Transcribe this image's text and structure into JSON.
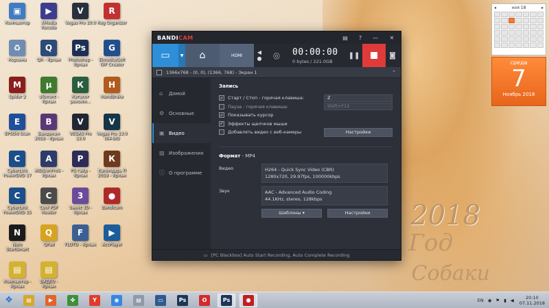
{
  "desktop": {
    "icons": [
      {
        "label": "Компьютер",
        "color": "#3f7cc4",
        "glyph": "▣"
      },
      {
        "label": "XMedia Recode",
        "color": "#3d3d8f",
        "glyph": "▶"
      },
      {
        "label": "Vegas Pro 10.0",
        "color": "#29303d",
        "glyph": "V"
      },
      {
        "label": "Reg Organizer",
        "color": "#c23030",
        "glyph": "R"
      },
      {
        "label": "Корзина",
        "color": "#6f8db3",
        "glyph": "♻"
      },
      {
        "label": "QR - Ярлык",
        "color": "#2c4b78",
        "glyph": "Q"
      },
      {
        "label": "Photoshop - Ярлык",
        "color": "#1d2f55",
        "glyph": "Ps"
      },
      {
        "label": "Elmedia/Soft GIF Creator",
        "color": "#224e8e",
        "glyph": "G"
      },
      {
        "label": "Spider 2",
        "color": "#8c1d1d",
        "glyph": "M"
      },
      {
        "label": "uTorrent - Ярлык",
        "color": "#3f7a2e",
        "glyph": "µ"
      },
      {
        "label": "Каталог рекомм...",
        "color": "#2b5d3f",
        "glyph": "К"
      },
      {
        "label": "HandBrake",
        "color": "#b35a1d",
        "glyph": "H"
      },
      {
        "label": "EPSON Scan",
        "color": "#1f4e9a",
        "glyph": "E"
      },
      {
        "label": "Бандикам 2018 - Ярлык",
        "color": "#5b3777",
        "glyph": "B"
      },
      {
        "label": "VEGAS Pro 13.0",
        "color": "#1f2634",
        "glyph": "V"
      },
      {
        "label": "Vegas Pro 13.0 (64-bit)",
        "color": "#163547",
        "glyph": "V"
      },
      {
        "label": "CyberLink PowerDVD 17",
        "color": "#1b4e8a",
        "glyph": "C"
      },
      {
        "label": "AIDS/enProS - Ярлык",
        "color": "#2d3c6a",
        "glyph": "A"
      },
      {
        "label": "PS гайд - Ярлык",
        "color": "#2c2c57",
        "glyph": "P"
      },
      {
        "label": "Календарь П 2018 - Ярлык",
        "color": "#6e3a1d",
        "glyph": "К"
      },
      {
        "label": "CyberLink PowerDVD 15",
        "color": "#1b4e8a",
        "glyph": "C"
      },
      {
        "label": "Cool PDF Reader",
        "color": "#4b4b4b",
        "glyph": "C"
      },
      {
        "label": "Sweet 3D - Ярлык",
        "color": "#6a4b9a",
        "glyph": "3"
      },
      {
        "label": "Bandicam",
        "color": "#b02929",
        "glyph": "●"
      },
      {
        "label": "Nero StartSmart",
        "color": "#1b1b1b",
        "glyph": "N"
      },
      {
        "label": "QPad",
        "color": "#d8a321",
        "glyph": "Q"
      },
      {
        "label": "FLOTO - Ярлык",
        "color": "#3b5f92",
        "glyph": "F"
      },
      {
        "label": "AccPlayer",
        "color": "#1b5d9a",
        "glyph": "▶"
      },
      {
        "label": "Компьютер - Ярлык",
        "color": "#d4b231",
        "glyph": "▤"
      },
      {
        "label": "ВИДЕО - Ярлык",
        "color": "#d4b231",
        "glyph": "▤"
      }
    ],
    "decor": {
      "year": "2018",
      "god": "Год",
      "sobaki": "Собаки"
    }
  },
  "calendar": {
    "month_label": "ноя 18",
    "weekday": "среда",
    "day": "7",
    "month_year": "Ноябрь 2018"
  },
  "bandicam": {
    "logo_main": "BANDI",
    "logo_accent": "CAM",
    "title_ctrls": {
      "folder": "▤",
      "help": "?",
      "minimize": "—",
      "close": "✕"
    },
    "modes": {
      "screen_icon": "▭",
      "game_icon": "⌂",
      "hdmi_label": "HDMI"
    },
    "timer": "00:00:00",
    "size": "0 bytes / 221.0GB",
    "target": "1366x768 - (0, 0), (1366, 768) - Экран 1",
    "sidebar": [
      {
        "label": "Домой",
        "icon": "⌂",
        "active": false
      },
      {
        "label": "Основные",
        "icon": "⚙",
        "active": false
      },
      {
        "label": "Видео",
        "icon": "▣",
        "active": true
      },
      {
        "label": "Изображения",
        "icon": "▨",
        "active": false
      },
      {
        "label": "О программе",
        "icon": "ⓘ",
        "active": false
      }
    ],
    "record": {
      "section": "Запись",
      "options": [
        {
          "label": "Старт / Стоп - горячая клавиша:",
          "checked": true,
          "value": "Z",
          "dim": false
        },
        {
          "label": "Пауза - горячая клавиша:",
          "checked": false,
          "value": "Shift+F12",
          "dim": true
        },
        {
          "label": "Показывать курсор",
          "checked": true
        },
        {
          "label": "Эффекты щелчков мыши",
          "checked": true
        },
        {
          "label": "Добавлять видео с веб-камеры",
          "checked": false
        }
      ],
      "settings_button": "Настройки"
    },
    "format": {
      "section": "Формат",
      "section_value": " - MP4",
      "video_label": "Видео",
      "video_line1": "H264 - Quick Sync Video (CBR)",
      "video_line2": "1280x720, 29.97fps, 100000kbps",
      "audio_label": "Звук",
      "audio_line1": "AAC - Advanced Audio Coding",
      "audio_line2": "44.1KHz, stereo, 128kbps",
      "templates_button": "Шаблоны",
      "settings_button": "Настройки"
    },
    "footer": "[PC Blackbox] Auto Start Recording, Auto Complete Recording"
  },
  "taskbar": {
    "apps": [
      {
        "glyph": "▤",
        "color": "#d7a62c",
        "active": false
      },
      {
        "glyph": "▶",
        "color": "#e0662b",
        "active": false
      },
      {
        "glyph": "✤",
        "color": "#3f8f3a",
        "active": false
      },
      {
        "glyph": "Y",
        "color": "#e23b2b",
        "active": false
      },
      {
        "glyph": "◉",
        "color": "#3a86e0",
        "active": false
      },
      {
        "glyph": "▤",
        "color": "#8f9aa8",
        "active": false
      },
      {
        "glyph": "▭",
        "color": "#2d5b8f",
        "active": false
      },
      {
        "glyph": "Ps",
        "color": "#1d3557",
        "active": false
      },
      {
        "glyph": "O",
        "color": "#d42a2a",
        "active": false
      },
      {
        "glyph": "Ps",
        "color": "#1d3557",
        "active": true
      },
      {
        "glyph": "●",
        "color": "#c21f1f",
        "active": true
      }
    ],
    "lang": "EN",
    "time": "20:10",
    "date": "07.11.2018"
  }
}
